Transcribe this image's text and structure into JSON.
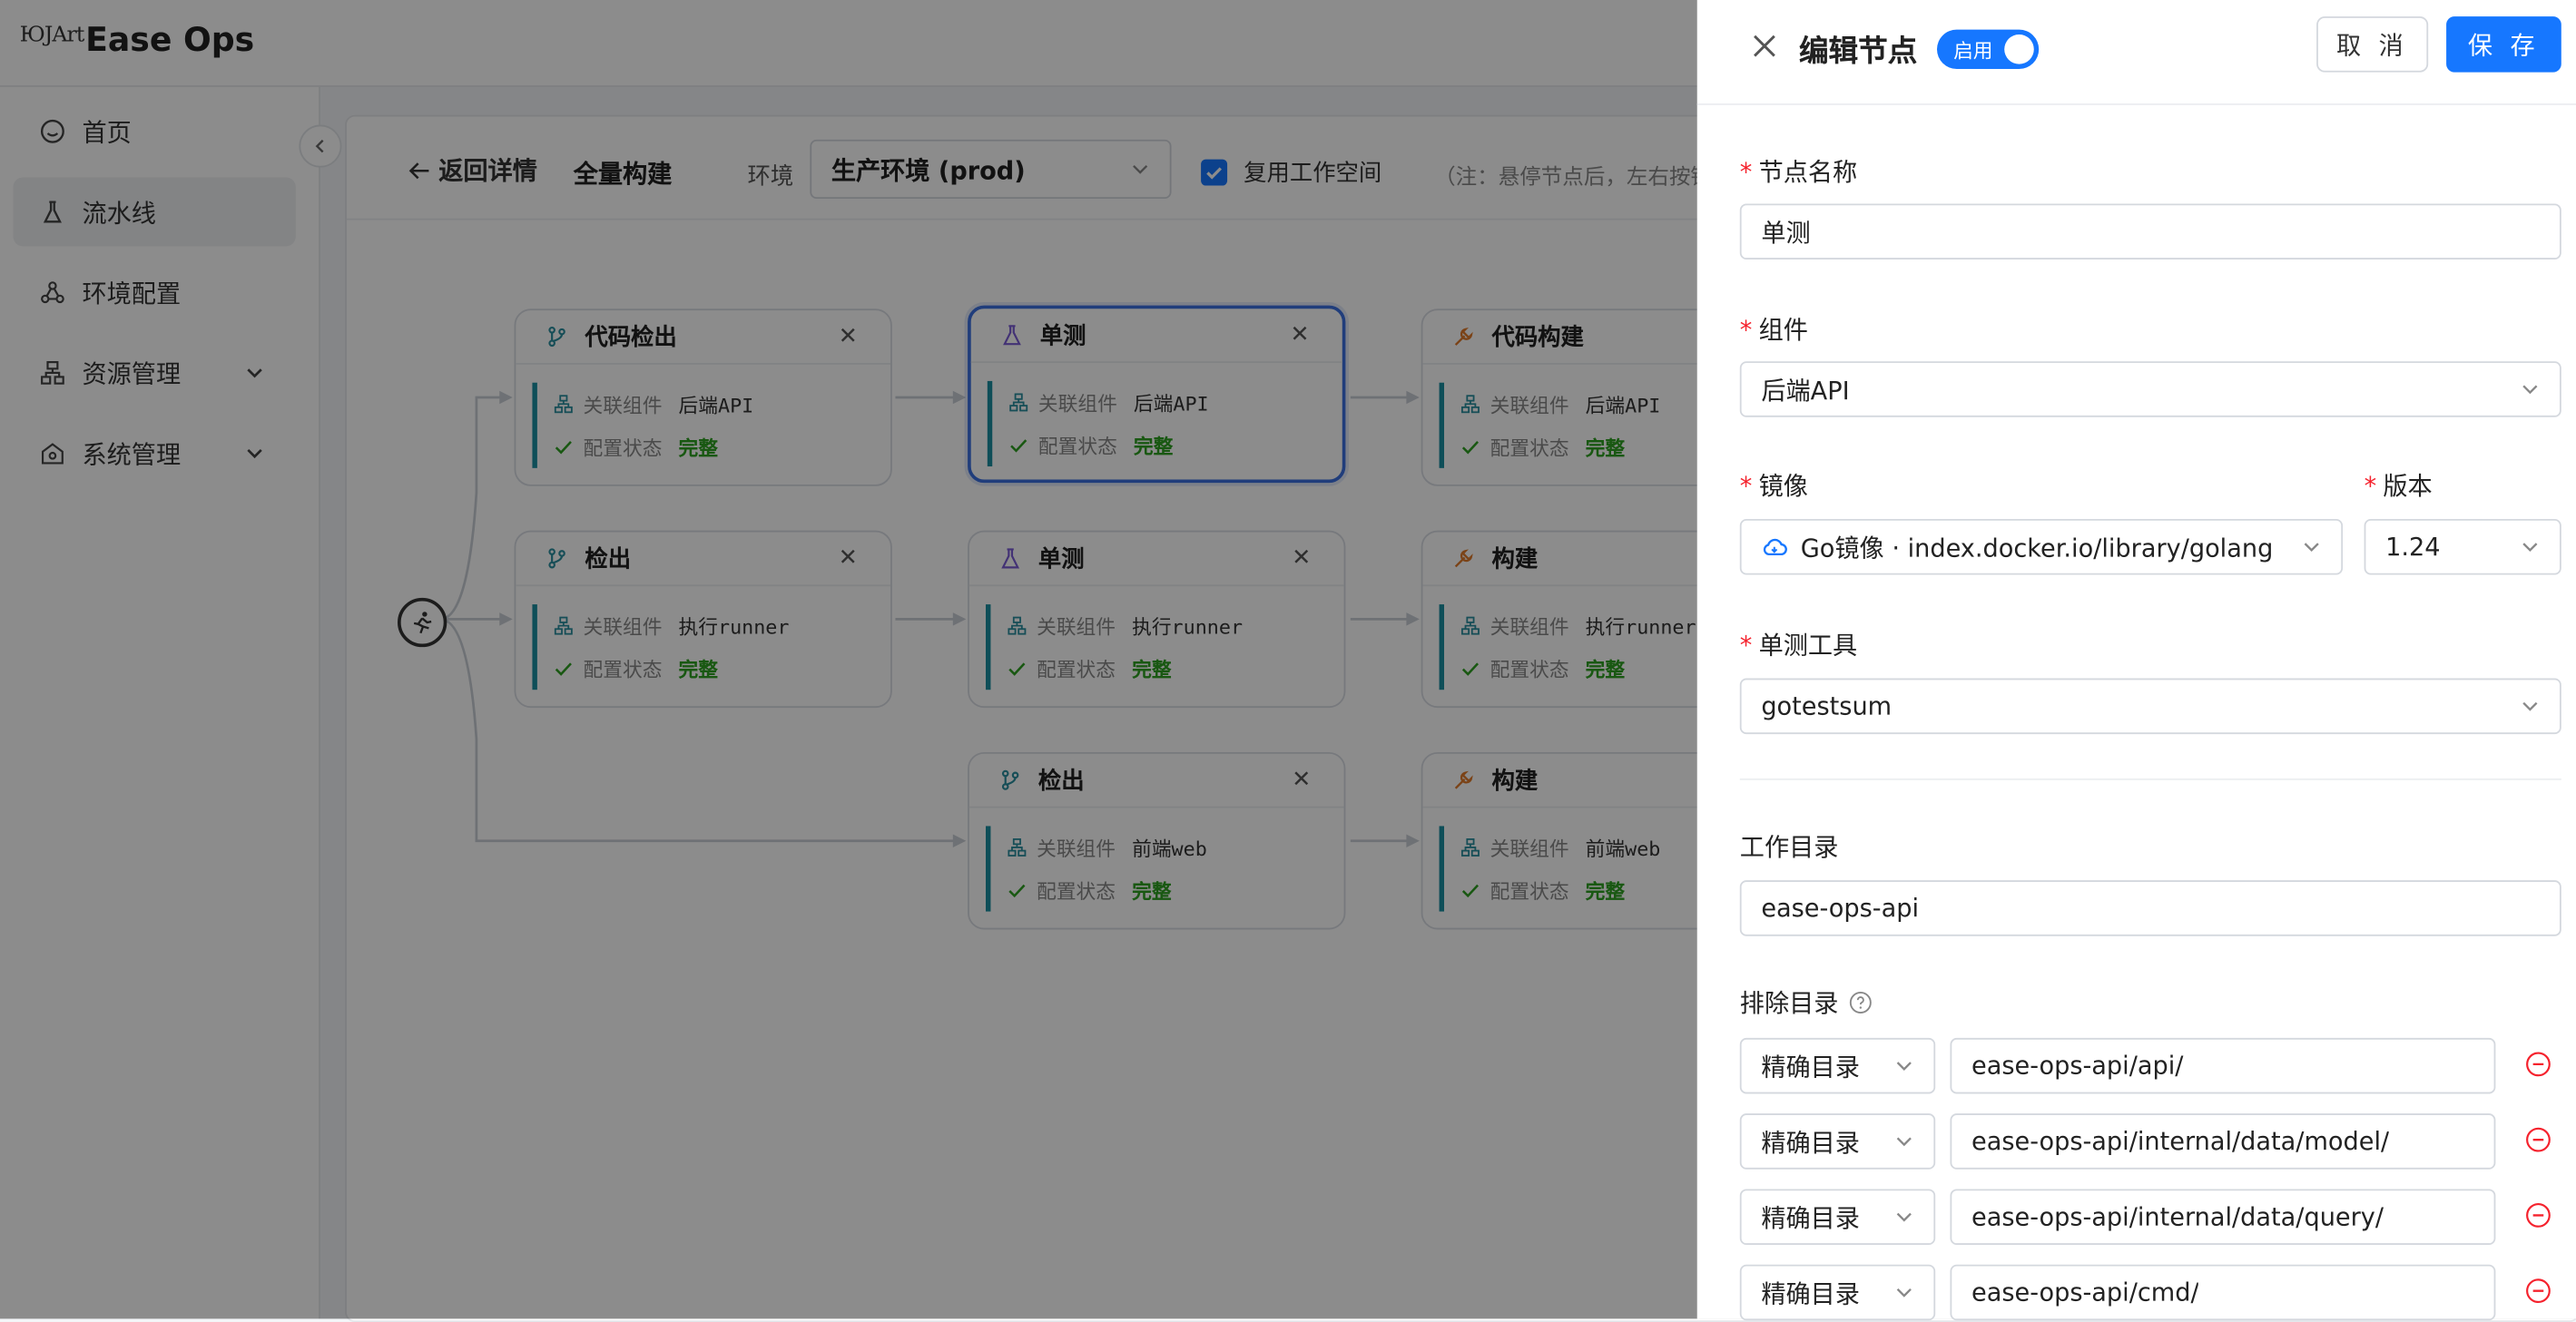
{
  "app": {
    "logo_text": "ЮJArt",
    "brand": "Ease Ops"
  },
  "sidebar": {
    "items": [
      {
        "label": "首页",
        "icon": "smile-icon"
      },
      {
        "label": "流水线",
        "icon": "flask-icon",
        "active": true
      },
      {
        "label": "环境配置",
        "icon": "nodes-icon"
      },
      {
        "label": "资源管理",
        "icon": "sitemap-icon",
        "expandable": true
      },
      {
        "label": "系统管理",
        "icon": "shield-home-icon",
        "expandable": true
      }
    ]
  },
  "toolbar": {
    "back_label": "返回详情",
    "pipeline_name": "全量构建",
    "env_label": "环境",
    "env_value": "生产环境 (prod)",
    "reuse_label": "复用工作空间",
    "reuse_checked": true,
    "note": "（注：悬停节点后，左右按钮"
  },
  "nodes": [
    {
      "title": "代码检出",
      "type": "checkout",
      "comp_key": "关联组件",
      "comp_val": "后端API",
      "status_key": "配置状态",
      "status_val": "完整"
    },
    {
      "title": "单测",
      "type": "test",
      "comp_key": "关联组件",
      "comp_val": "后端API",
      "status_key": "配置状态",
      "status_val": "完整",
      "selected": true
    },
    {
      "title": "代码构建",
      "type": "build",
      "comp_key": "关联组件",
      "comp_val": "后端API",
      "status_key": "配置状态",
      "status_val": "完整"
    },
    {
      "title": "检出",
      "type": "checkout",
      "comp_key": "关联组件",
      "comp_val": "执行runner",
      "status_key": "配置状态",
      "status_val": "完整"
    },
    {
      "title": "单测",
      "type": "test",
      "comp_key": "关联组件",
      "comp_val": "执行runner",
      "status_key": "配置状态",
      "status_val": "完整"
    },
    {
      "title": "构建",
      "type": "build",
      "comp_key": "关联组件",
      "comp_val": "执行runner",
      "status_key": "配置状态",
      "status_val": "完整"
    },
    {
      "title": "检出",
      "type": "checkout",
      "comp_key": "关联组件",
      "comp_val": "前端web",
      "status_key": "配置状态",
      "status_val": "完整"
    },
    {
      "title": "构建",
      "type": "build",
      "comp_key": "关联组件",
      "comp_val": "前端web",
      "status_key": "配置状态",
      "status_val": "完整"
    }
  ],
  "drawer": {
    "title": "编辑节点",
    "toggle_label": "启用",
    "toggle_on": true,
    "cancel_label": "取 消",
    "save_label": "保 存",
    "fields": {
      "node_name": {
        "label": "节点名称",
        "value": "单测"
      },
      "component": {
        "label": "组件",
        "value": "后端API"
      },
      "image": {
        "label": "镜像",
        "value": "Go镜像 · index.docker.io/library/golang"
      },
      "version": {
        "label": "版本",
        "value": "1.24"
      },
      "test_tool": {
        "label": "单测工具",
        "value": "gotestsum"
      },
      "workdir": {
        "label": "工作目录",
        "value": "ease-ops-api"
      },
      "exclude": {
        "label": "排除目录",
        "rows": [
          {
            "mode": "精确目录",
            "path": "ease-ops-api/api/"
          },
          {
            "mode": "精确目录",
            "path": "ease-ops-api/internal/data/model/"
          },
          {
            "mode": "精确目录",
            "path": "ease-ops-api/internal/data/query/"
          },
          {
            "mode": "精确目录",
            "path": "ease-ops-api/cmd/"
          }
        ]
      }
    }
  },
  "colors": {
    "primary": "#1677ff",
    "ok": "#2ea121",
    "required": "#f5222d",
    "node_accent": "#1a8fa0"
  }
}
